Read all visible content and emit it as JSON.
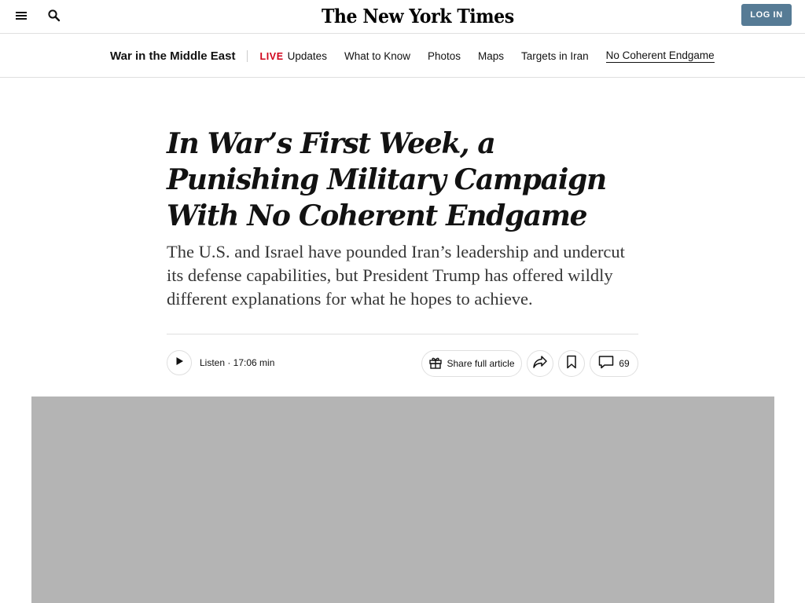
{
  "masthead": {
    "logo_text": "The New York Times",
    "menu_icon": "hamburger-menu-icon",
    "search_icon": "search-icon",
    "login_label": "LOG IN",
    "login_color": "#567b95"
  },
  "subnav": {
    "section_title": "War in the Middle East",
    "live_tag": "LIVE",
    "live_color": "#d0021b",
    "links": [
      "Updates",
      "What to Know",
      "Photos",
      "Maps",
      "Targets in Iran",
      "No Coherent Endgame"
    ],
    "active_link": "No Coherent Endgame"
  },
  "article": {
    "headline": "In War’s First Week, a Punishing Military Campaign With No Coherent Endgame",
    "summary": "The U.S. and Israel have pounded Iran’s leadership and undercut its defense capabilities, but President Trump has offered wildly different explanations for what he hopes to achieve.",
    "listen_label": "Listen · 17:06 min",
    "share_label": "Share full article",
    "comment_count": "69",
    "icons": [
      "play-icon",
      "gift-icon",
      "share-forward-icon",
      "bookmark-icon",
      "comment-icon"
    ]
  }
}
